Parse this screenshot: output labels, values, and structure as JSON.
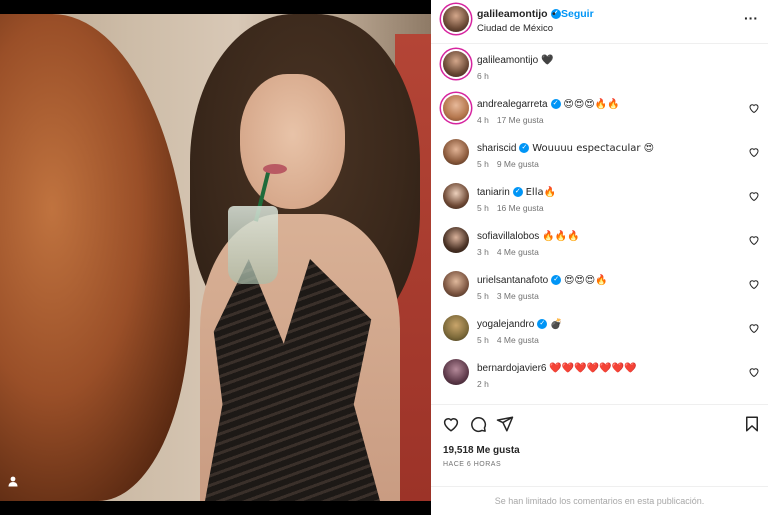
{
  "post": {
    "username": "galileamontijo",
    "follow_label": "Seguir",
    "separator": "•",
    "location": "Ciudad de México",
    "more_icon": "more-options-icon"
  },
  "caption": {
    "username": "galileamontijo",
    "text": "🖤",
    "time": "6 h"
  },
  "comments": [
    {
      "username": "andrealegarreta",
      "verified": true,
      "text": "😍😍😍🔥🔥",
      "time": "4 h",
      "likes": "17 Me gusta"
    },
    {
      "username": "shariscid",
      "verified": true,
      "text": "Wouuuu espectacular 😍",
      "time": "5 h",
      "likes": "9 Me gusta"
    },
    {
      "username": "taniarin",
      "verified": true,
      "text": "Ella🔥",
      "time": "5 h",
      "likes": "16 Me gusta"
    },
    {
      "username": "sofiavillalobos",
      "verified": false,
      "text": "🔥🔥🔥",
      "time": "3 h",
      "likes": "4 Me gusta"
    },
    {
      "username": "urielsantanafoto",
      "verified": true,
      "text": "😍😍😍🔥",
      "time": "5 h",
      "likes": "3 Me gusta"
    },
    {
      "username": "yogalejandro",
      "verified": true,
      "text": "💣",
      "time": "5 h",
      "likes": "4 Me gusta"
    },
    {
      "username": "bernardojavier6",
      "verified": false,
      "text": "❤️❤️❤️❤️❤️❤️❤️",
      "time": "2 h",
      "likes": ""
    }
  ],
  "footer": {
    "likes_count": "19,518 Me gusta",
    "time_ago": "HACE 6 HORAS",
    "limited_notice": "Se han limitado los comentarios en esta publicación."
  },
  "colors": {
    "link_blue": "#0095f6",
    "story_ring": "#d6249f",
    "meta_gray": "#737373"
  }
}
